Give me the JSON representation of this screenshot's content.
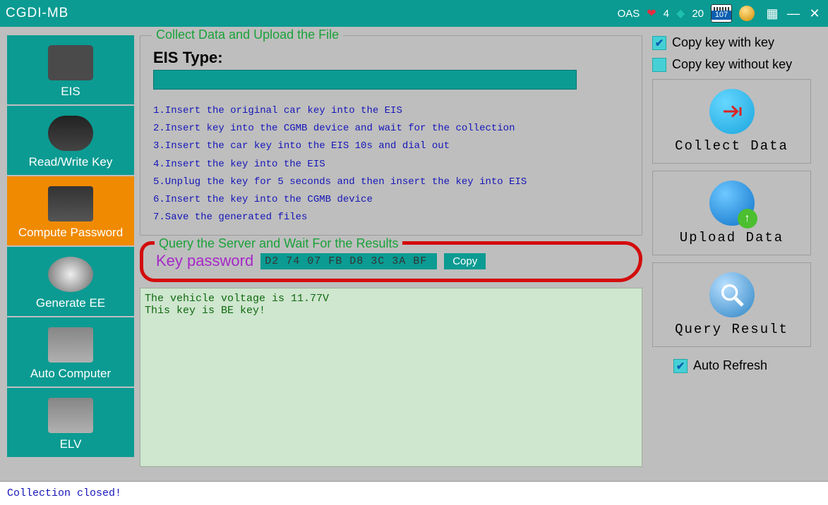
{
  "titlebar": {
    "title": "CGDI-MB",
    "oas_label": "OAS",
    "hearts": "4",
    "diamonds": "20",
    "calendar": "107"
  },
  "sidebar": {
    "items": [
      {
        "label": "EIS"
      },
      {
        "label": "Read/Write Key"
      },
      {
        "label": "Compute Password"
      },
      {
        "label": "Generate EE"
      },
      {
        "label": "Auto Computer"
      },
      {
        "label": "ELV"
      }
    ]
  },
  "main": {
    "collect_legend": "Collect Data and Upload the File",
    "eis_type_label": "EIS Type:",
    "eis_type_value": "",
    "instructions": [
      "1.Insert the original car key into the EIS",
      "2.Insert key into the CGMB device and wait for the collection",
      "3.Insert the car key into the EIS 10s and dial out",
      "4.Insert the key into the EIS",
      "5.Unplug the key for 5 seconds and then insert the key into EIS",
      "6.Insert the key into the CGMB device",
      "7.Save the generated files"
    ],
    "query_legend": "Query the Server and Wait For the Results",
    "key_password_label": "Key password",
    "key_password_value": "D2 74 07 FB D8 3C 3A BF",
    "copy_btn": "Copy",
    "log": "The vehicle voltage is 11.77V\nThis key is BE key!"
  },
  "options": {
    "copy_with": "Copy key with key",
    "copy_without": "Copy key without key",
    "collect_data": "Collect Data",
    "upload_data": "Upload  Data",
    "query_result": "Query Result",
    "auto_refresh": "Auto Refresh"
  },
  "statusbar": {
    "text": "Collection closed!"
  }
}
